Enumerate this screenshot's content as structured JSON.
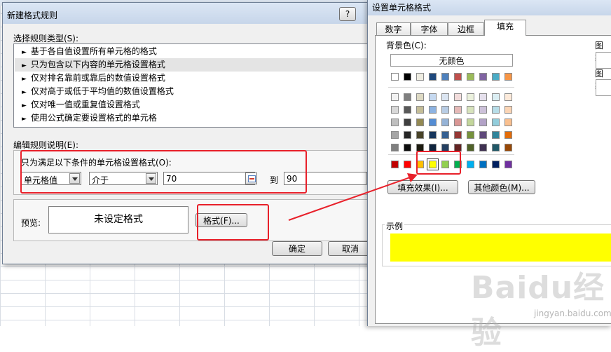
{
  "left_dialog": {
    "title": "新建格式规则",
    "help": "?",
    "rule_type_label": "选择规则类型(S):",
    "rule_types": [
      "基于各自值设置所有单元格的格式",
      "只为包含以下内容的单元格设置格式",
      "仅对排名靠前或靠后的数值设置格式",
      "仅对高于或低于平均值的数值设置格式",
      "仅对唯一值或重复值设置格式",
      "使用公式确定要设置格式的单元格"
    ],
    "selected_rule_index": 1,
    "edit_desc_label": "编辑规则说明(E):",
    "condition_label": "只为满足以下条件的单元格设置格式(O):",
    "condition_field": "单元格值",
    "condition_operator": "介于",
    "value_from": "70",
    "to_label": "到",
    "value_to": "90",
    "preview_label": "预览:",
    "preview_text": "未设定格式",
    "format_button": "格式(F)...",
    "ok_button": "确定",
    "cancel_button": "取消"
  },
  "right_dialog": {
    "title": "设置单元格格式",
    "tabs": [
      "数字",
      "字体",
      "边框",
      "填充"
    ],
    "active_tab": "填充",
    "bg_color_label": "背景色(C):",
    "no_color_button": "无颜色",
    "theme_colors_top": [
      "#ffffff",
      "#000000",
      "#eeece1",
      "#1f497d",
      "#4f81bd",
      "#c0504d",
      "#9bbb59",
      "#8064a2",
      "#4bacc6",
      "#f79646"
    ],
    "theme_tints": [
      [
        "#f2f2f2",
        "#7f7f7f",
        "#ddd9c3",
        "#c6d9f0",
        "#dbe5f1",
        "#f2dcdb",
        "#ebf1dd",
        "#e5e0ec",
        "#dbeef3",
        "#fdeada"
      ],
      [
        "#d8d8d8",
        "#595959",
        "#c4bd97",
        "#8db3e2",
        "#b8cce4",
        "#e5b9b7",
        "#d7e3bc",
        "#ccc1d9",
        "#b7dde8",
        "#fbd5b5"
      ],
      [
        "#bfbfbf",
        "#3f3f3f",
        "#938953",
        "#548dd4",
        "#95b3d7",
        "#d99694",
        "#c3d69b",
        "#b2a2c7",
        "#92cddc",
        "#fac08f"
      ],
      [
        "#a5a5a5",
        "#262626",
        "#494429",
        "#17365d",
        "#366092",
        "#953734",
        "#76923c",
        "#5f497a",
        "#31859b",
        "#e36c09"
      ],
      [
        "#7f7f7f",
        "#0c0c0c",
        "#1d1b10",
        "#0f243e",
        "#244061",
        "#632423",
        "#4f6128",
        "#3f3151",
        "#205867",
        "#974806"
      ]
    ],
    "standard_colors": [
      "#c00000",
      "#ff0000",
      "#ffc000",
      "#ffff00",
      "#92d050",
      "#00b050",
      "#00b0f0",
      "#0070c0",
      "#002060",
      "#7030a0"
    ],
    "selected_standard_index": 3,
    "fill_effects_button": "填充效果(I)...",
    "more_colors_button": "其他颜色(M)...",
    "pattern_color_label": "图案",
    "pattern_style_label": "图案",
    "sample_label": "示例",
    "sample_color": "#ffff00"
  },
  "watermark": {
    "logo": "Baidu经验",
    "url": "jingyan.baidu.com"
  },
  "colors": {
    "highlight_red": "#e8202a"
  }
}
